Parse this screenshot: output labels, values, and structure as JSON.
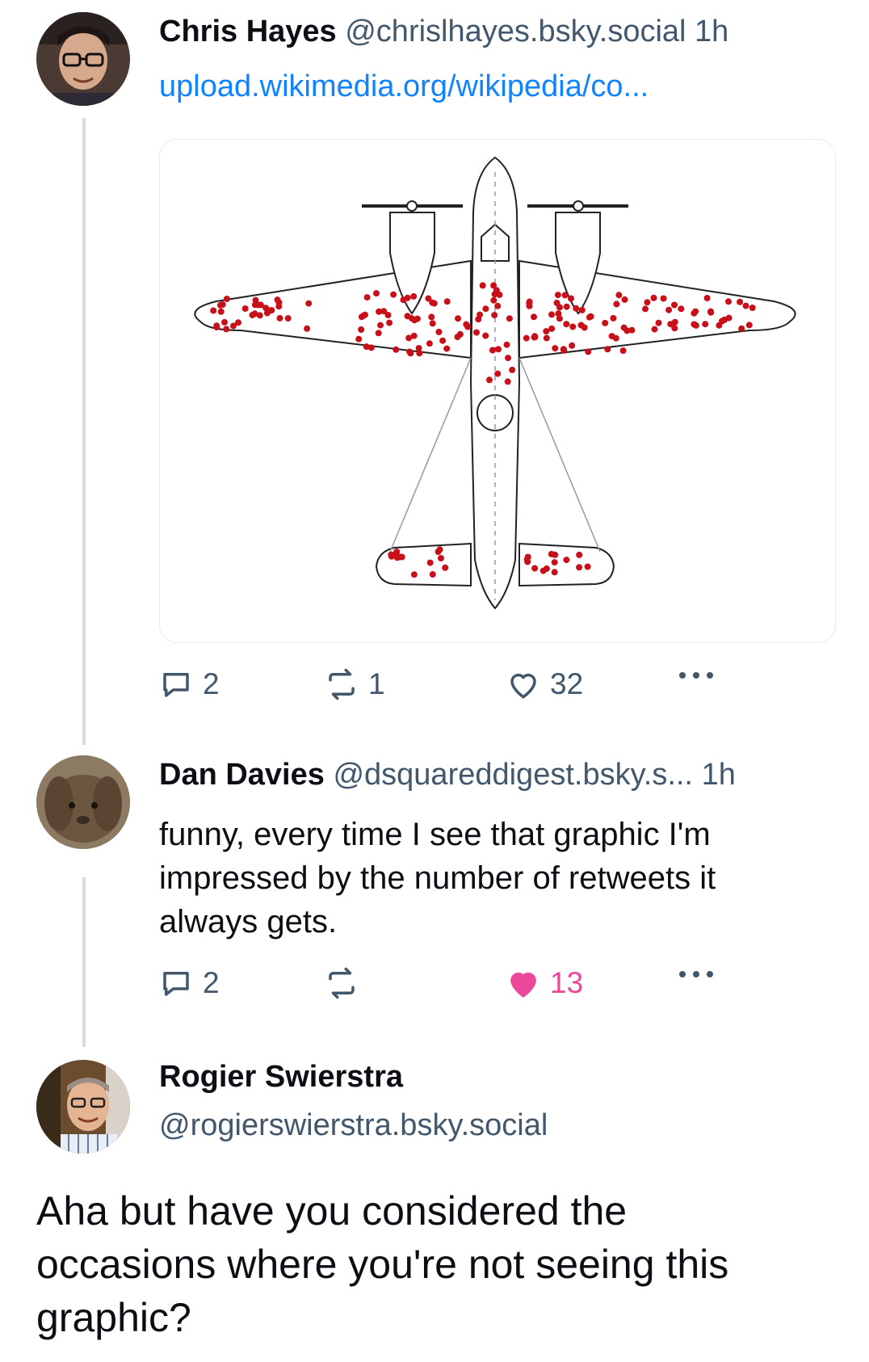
{
  "posts": [
    {
      "author": "Chris Hayes",
      "handle": "@chrislhayes.bsky.social",
      "time": "1h",
      "link": "upload.wikimedia.org/wikipedia/co...",
      "replies": "2",
      "reposts": "1",
      "likes": "32",
      "liked": false
    },
    {
      "author": "Dan Davies",
      "handle": "@dsquareddigest.bsky.s...",
      "time": "1h",
      "text_lines": [
        "funny, every time I see that graphic I'm",
        "impressed by the number of retweets it",
        "always gets."
      ],
      "replies": "2",
      "reposts": "",
      "likes": "13",
      "liked": true
    },
    {
      "author": "Rogier Swierstra",
      "handle": "@rogierswierstra.bsky.social",
      "text_lines": [
        "Aha but have you considered the",
        "occasions where you're not seeing this",
        "graphic?"
      ]
    }
  ],
  "colors": {
    "link": "#1083fe",
    "muted": "#42576c",
    "like_active": "#ec4899",
    "damage_dot": "#c8101a"
  },
  "icons": [
    "reply-icon",
    "repost-icon",
    "heart-icon",
    "more-icon"
  ]
}
